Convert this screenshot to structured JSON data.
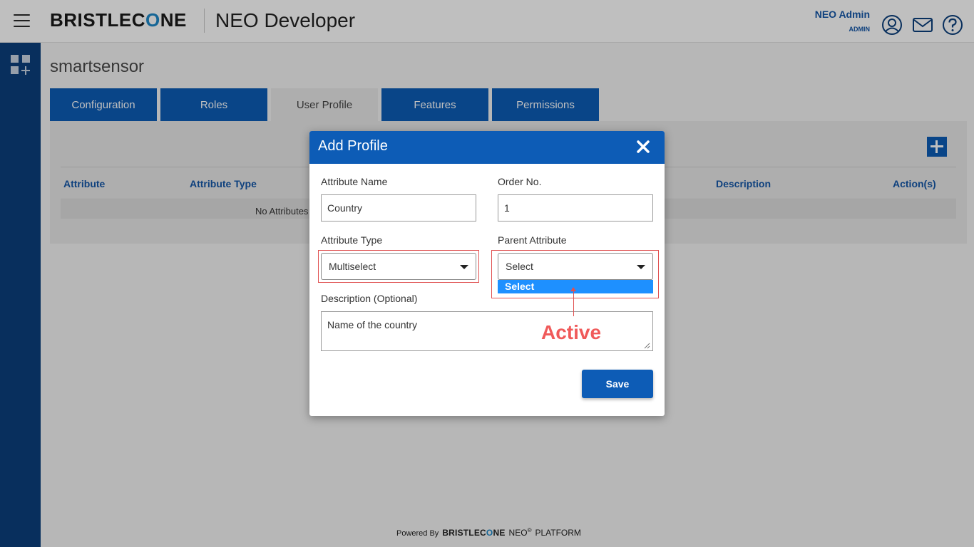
{
  "header": {
    "brand": {
      "pre": "BRISTLEC",
      "mark": "O",
      "post": "NE"
    },
    "app_title": "NEO Developer",
    "user_name": "NEO Admin",
    "user_role": "ADMIN",
    "icons": [
      "user-circle-icon",
      "mail-icon",
      "help-icon"
    ]
  },
  "sidebar": {
    "icon": "dashboard-add-icon"
  },
  "page": {
    "title": "smartsensor",
    "tabs": [
      {
        "label": "Configuration",
        "active": false
      },
      {
        "label": "Roles",
        "active": false
      },
      {
        "label": "User Profile",
        "active": true
      },
      {
        "label": "Features",
        "active": false
      },
      {
        "label": "Permissions",
        "active": false
      }
    ],
    "table": {
      "columns": [
        "Attribute",
        "Attribute Type",
        "Description",
        "Action(s)"
      ],
      "empty_text": "No Attributes"
    }
  },
  "modal": {
    "title": "Add Profile",
    "attribute_name": {
      "label": "Attribute Name",
      "value": "Country"
    },
    "order_no": {
      "label": "Order No.",
      "value": "1"
    },
    "attribute_type": {
      "label": "Attribute Type",
      "value": "Multiselect"
    },
    "parent_attribute": {
      "label": "Parent Attribute",
      "value": "Select",
      "options": [
        "Select"
      ]
    },
    "description": {
      "label": "Description (Optional)",
      "value": "Name of the country"
    },
    "save_label": "Save"
  },
  "annotation": {
    "text": "Active",
    "color": "#f05a5a"
  },
  "footer": {
    "powered_by": "Powered By",
    "brand": {
      "pre": "BRISTLEC",
      "mark": "O",
      "post": "NE"
    },
    "neo": "NEO",
    "reg": "®",
    "platform": "PLATFORM"
  },
  "colors": {
    "primary": "#0d5cb6",
    "sidebar": "#0b3f7d",
    "header_link": "#1457a8",
    "highlight": "#1e90ff",
    "annotation": "#e05050"
  }
}
